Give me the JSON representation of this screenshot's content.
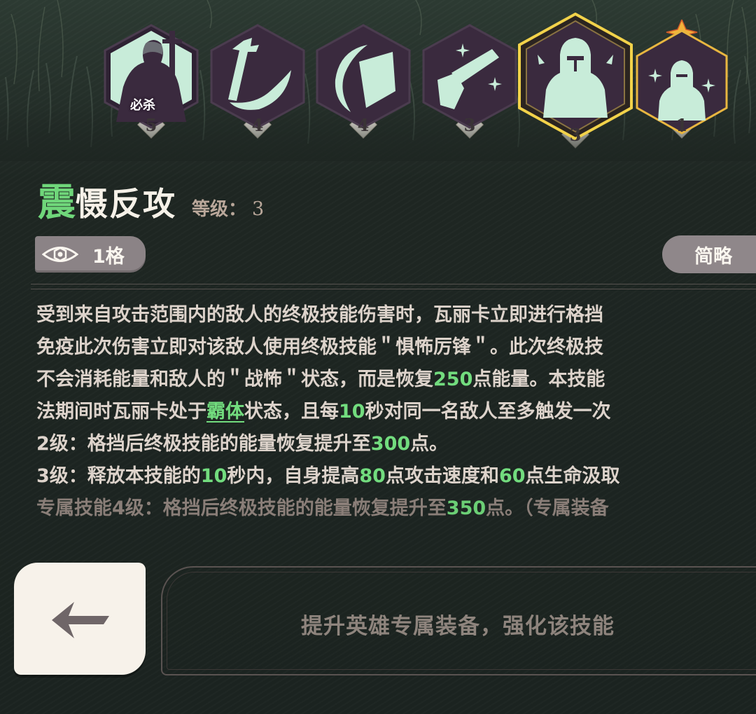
{
  "skills": [
    {
      "name": "ultimate",
      "level": "5",
      "tag": "必杀",
      "selected": false,
      "icon": "swordswoman-silhouette-icon"
    },
    {
      "name": "skill-2",
      "level": "4",
      "selected": false,
      "icon": "sword-sweep-icon"
    },
    {
      "name": "skill-3",
      "level": "4",
      "selected": false,
      "icon": "shield-crescent-icon"
    },
    {
      "name": "skill-4",
      "level": "3",
      "selected": false,
      "icon": "sword-fist-icon"
    },
    {
      "name": "skill-5",
      "level": "3",
      "selected": true,
      "icon": "knight-helm-icon"
    },
    {
      "name": "skill-6",
      "level": "1",
      "selected": false,
      "exclusive": true,
      "icon": "knight-sparkle-icon"
    }
  ],
  "detail": {
    "title_first": "震",
    "title_rest": "慑反攻",
    "level_label": "等级：",
    "level_value": "3",
    "range": "1格",
    "brief_button": "简略"
  },
  "description": {
    "line1": "受到来自攻击范围内的敌人的终极技能伤害时，瓦丽卡立即进行格挡",
    "line2": "免疫此次伤害立即对该敌人使用终极技能＂惧怖厉锋＂。此次终极技",
    "line3_a": "不会消耗能量和敌人的＂战怖＂状态，而是恢复",
    "line3_b": "250",
    "line3_c": "点能量。本技能",
    "line4_a": "法期间时瓦丽卡处于",
    "line4_b": "霸体",
    "line4_c": "状态，且每",
    "line4_d": "10",
    "line4_e": "秒对同一名敌人至多触发一次",
    "line5_a": "2级：格挡后终极技能的能量恢复提升至",
    "line5_b": "300",
    "line5_c": "点。",
    "line6_a": "3级：释放本技能的",
    "line6_b": "10",
    "line6_c": "秒内，自身提高",
    "line6_d": "80",
    "line6_e": "点攻击速度和",
    "line6_f": "60",
    "line6_g": "点生命汲取",
    "line7_a": "专属技能4级：格挡后终极技能的能量恢复提升至",
    "line7_b": "350",
    "line7_c": "点。（专属装备"
  },
  "bottom": {
    "upgrade_text": "提升英雄专属装备，强化该技能"
  },
  "colors": {
    "accent_green": "#72dc7e",
    "icon_mint": "#c8ecd9",
    "hex_purple": "#3a2a3e",
    "selected_gold": "#f2d24a"
  }
}
